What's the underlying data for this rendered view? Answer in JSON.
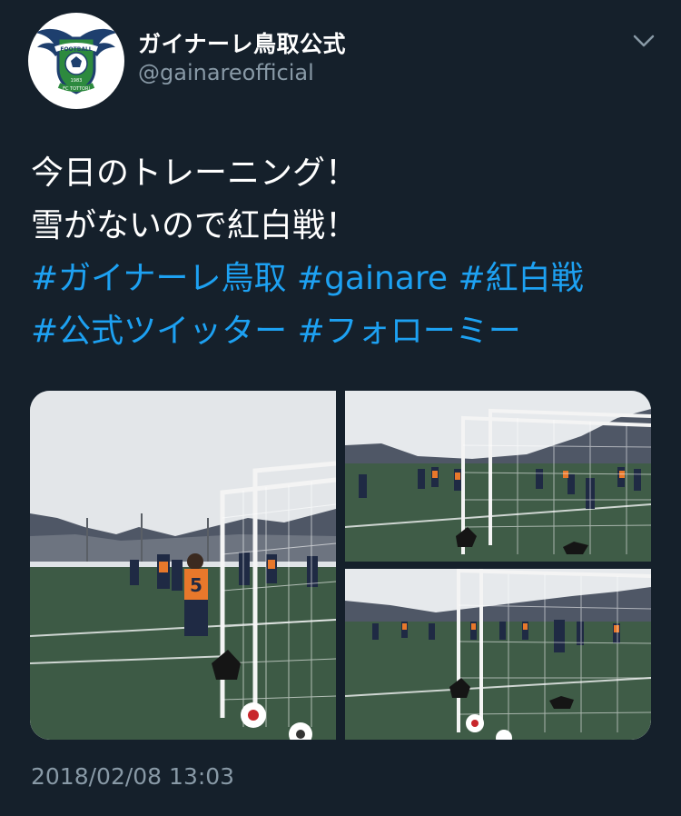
{
  "author": {
    "display_name": "ガイナーレ鳥取公式",
    "handle": "@gainareofficial",
    "avatar_icon": "gainare-crest-icon",
    "avatar_text": {
      "top": "FOOTBALL",
      "bottom": "FC TOTTORI",
      "year": "1983"
    }
  },
  "menu": {
    "icon": "chevron-down-icon"
  },
  "tweet": {
    "line1": "今日のトレーニング！",
    "line2": "雪がないので紅白戦！",
    "hashtags": [
      "#ガイナーレ鳥取",
      "#gainare",
      "#紅白戦",
      "#公式ツイッター",
      "#フォローミー"
    ]
  },
  "media": {
    "count": 3,
    "bib_number": "5"
  },
  "timestamp": "2018/02/08 13:03",
  "colors": {
    "background": "#15202b",
    "text": "#ffffff",
    "secondary_text": "#8899a6",
    "link": "#1da1f2"
  }
}
